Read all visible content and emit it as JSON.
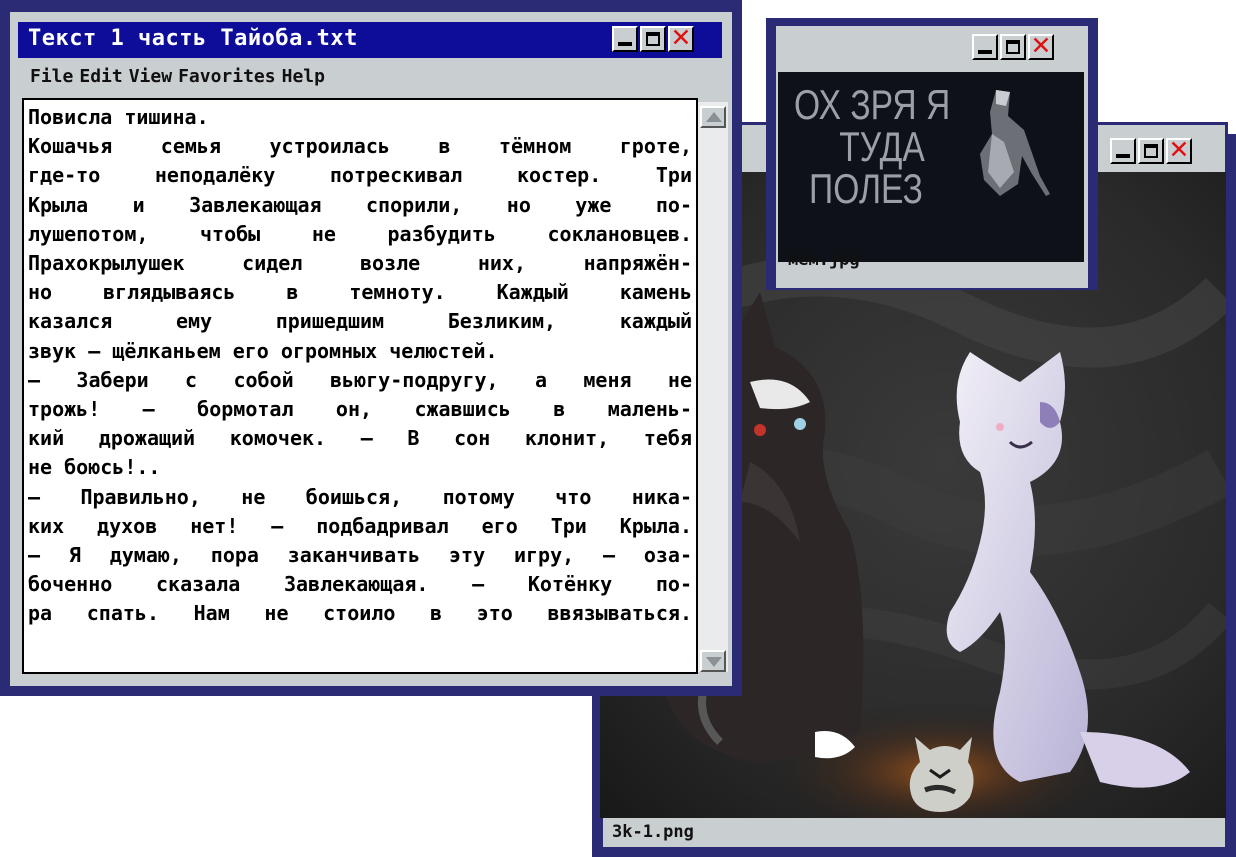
{
  "text_window": {
    "title": "Текст 1 часть Тайоба.txt",
    "menu": [
      "File",
      "Edit",
      "View",
      "Favorites",
      "Help"
    ],
    "lines": [
      "Повисла тишина.",
      "Кошачья семья устроилась в тёмном гроте,",
      "где-то неподалёку потрескивал костер. Три",
      "Крыла и Завлекающая спорили, но уже по-",
      "лушепотом, чтобы не разбудить соклановцев.",
      "Прахокрылушек сидел возле них, напряжён-",
      "но вглядываясь в темноту. Каждый камень",
      "казался ему пришедшим Безликим, каждый",
      "звук — щёлканьем его огромных челюстей.",
      "— Забери с собой вьюгу-подругу, а меня не",
      "трожь! — бормотал он, сжавшись в малень-",
      "кий дрожащий комочек. — В сон клонит, тебя",
      "не боюсь!..",
      "— Правильно, не боишься, потому что ника-",
      "ких духов нет! — подбадривал его Три Крыла.",
      "— Я думаю, пора заканчивать эту игру, — оза-",
      "боченно сказала Завлекающая. — Котёнку по-",
      "ра спать. Нам не стоило в это ввязываться."
    ],
    "last_line_indices": [
      0,
      8,
      12
    ]
  },
  "image_window": {
    "filename": "3k-1.png"
  },
  "meme_window": {
    "filename": "мем.jpg",
    "meme_text": [
      "ОХ ЗРЯ Я",
      "ТУДА",
      "ПОЛЕЗ"
    ]
  },
  "window_buttons": {
    "minimize_icon": "minimize-icon",
    "maximize_icon": "maximize-icon",
    "close_icon": "close-icon",
    "close_glyph": "✕"
  },
  "colors": {
    "title_bar": "#0d0d9a",
    "frame": "#c9ced1",
    "border_shadow": "#2b2a74",
    "close_red": "#e01010"
  }
}
